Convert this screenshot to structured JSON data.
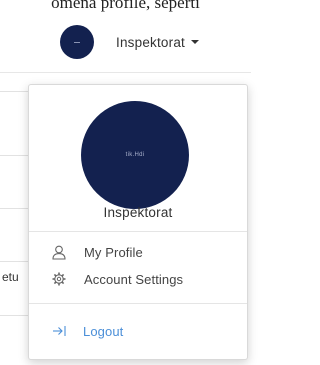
{
  "top_fragment": "omena profile, seperti",
  "navbar": {
    "avatar_color": "#13214f",
    "user_name": "Inspektorat"
  },
  "dropdown": {
    "avatar_text": "tik.Hdi",
    "user_name": "Inspektorat",
    "items": [
      {
        "label": "My Profile",
        "icon": "user-icon"
      },
      {
        "label": "Account Settings",
        "icon": "gear-icon"
      }
    ],
    "logout": {
      "label": "Logout",
      "icon": "sign-out-icon",
      "color": "#4b8fd8"
    }
  },
  "background": {
    "text_fragment": "etu"
  }
}
